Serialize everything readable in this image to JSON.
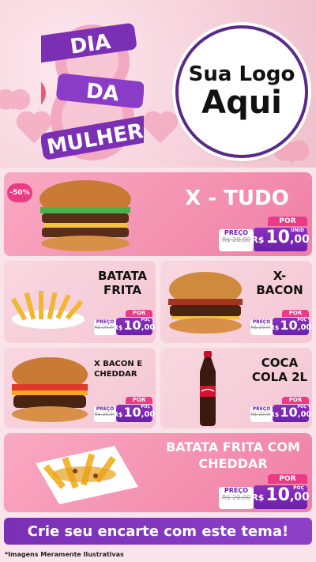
{
  "header": {
    "title_line1": "DIA",
    "title_line2": "DA",
    "title_line3": "MULHER",
    "logo_line1": "Sua Logo",
    "logo_line2": "Aqui"
  },
  "products": [
    {
      "name": "X - TUDO",
      "badge": "-50%",
      "por": "POR",
      "preco": "PREÇO",
      "currency": "R$",
      "old": "R$ 20,00",
      "price_int": "10",
      "price_dec": ",00",
      "unit": "UNID"
    },
    {
      "name": "BATATA\nFRITA",
      "por": "POR",
      "preco": "PREÇO",
      "currency": "R$",
      "old": "R$ 20,00",
      "price_int": "10",
      "price_dec": ",00",
      "unit": "POÇ"
    },
    {
      "name": "X-\nBACON",
      "por": "POR",
      "preco": "PREÇO",
      "currency": "R$",
      "old": "R$ 20,00",
      "price_int": "10",
      "price_dec": ",00",
      "unit": "POÇ"
    },
    {
      "name": "X BACON E\nCHEDDAR",
      "por": "POR",
      "preco": "PREÇO",
      "currency": "R$",
      "old": "R$ 20,00",
      "price_int": "10",
      "price_dec": ",00",
      "unit": "POÇ"
    },
    {
      "name": "COCA\nCOLA 2L",
      "por": "POR",
      "preco": "PREÇO",
      "currency": "R$",
      "old": "R$ 20,00",
      "price_int": "10",
      "price_dec": ",00",
      "unit": "POÇ"
    },
    {
      "name": "BATATA FRITA COM\nCHEDDAR",
      "por": "POR",
      "preco": "PREÇO",
      "currency": "R$",
      "old": "R$ 20,00",
      "price_int": "10",
      "price_dec": ",00",
      "unit": "POÇ"
    }
  ],
  "cta": "Crie seu encarte com este tema!",
  "footer": "*Imagens Meramente Ilustrativas",
  "colors": {
    "purple": "#6a21a8",
    "pink": "#ec3b85"
  }
}
